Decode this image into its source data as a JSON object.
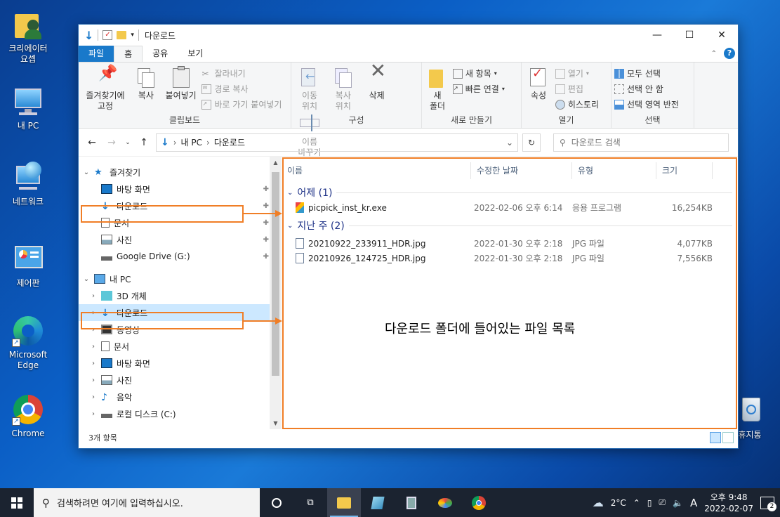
{
  "desktop": {
    "icons": [
      {
        "label": "크리에이터\n요셉"
      },
      {
        "label": "내 PC"
      },
      {
        "label": "네트워크"
      },
      {
        "label": "제어판"
      },
      {
        "label": "Microsoft Edge"
      },
      {
        "label": "Chrome"
      },
      {
        "label": "휴지통"
      }
    ]
  },
  "window": {
    "title": "다운로드",
    "tabs": {
      "file": "파일",
      "home": "홈",
      "share": "공유",
      "view": "보기"
    },
    "ribbon": {
      "clipboard": {
        "pin": "즐겨찾기에\n고정",
        "copy": "복사",
        "paste": "붙여넣기",
        "cut": "잘라내기",
        "copy_path": "경로 복사",
        "paste_shortcut": "바로 가기 붙여넣기",
        "label": "클립보드"
      },
      "organize": {
        "move": "이동\n위치",
        "copy_to": "복사\n위치",
        "delete": "삭제",
        "rename": "이름\n바꾸기",
        "label": "구성"
      },
      "new": {
        "new_folder": "새\n폴더",
        "new_item": "새 항목",
        "easy_access": "빠른 연결",
        "label": "새로 만들기"
      },
      "open": {
        "properties": "속성",
        "open": "열기",
        "edit": "편집",
        "history": "히스토리",
        "label": "열기"
      },
      "select": {
        "select_all": "모두 선택",
        "select_none": "선택 안 함",
        "invert": "선택 영역 반전",
        "label": "선택"
      }
    },
    "address": {
      "crumbs": [
        "내 PC",
        "다운로드"
      ]
    },
    "search_placeholder": "다운로드 검색",
    "nav": {
      "quick_access": "즐겨찾기",
      "quick_items": [
        "바탕 화면",
        "다운로드",
        "문서",
        "사진",
        "Google Drive (G:)"
      ],
      "this_pc": "내 PC",
      "pc_items": [
        "3D 개체",
        "다운로드",
        "동영상",
        "문서",
        "바탕 화면",
        "사진",
        "음악",
        "로컬 디스크 (C:)"
      ]
    },
    "columns": {
      "name": "이름",
      "modified": "수정한 날짜",
      "type": "유형",
      "size": "크기"
    },
    "groups": [
      {
        "title": "어제 (1)",
        "files": [
          {
            "name": "picpick_inst_kr.exe",
            "date": "2022-02-06 오후 6:14",
            "type": "응용 프로그램",
            "size": "16,254KB"
          }
        ]
      },
      {
        "title": "지난 주 (2)",
        "files": [
          {
            "name": "20210922_233911_HDR.jpg",
            "date": "2022-01-30 오후 2:18",
            "type": "JPG 파일",
            "size": "4,077KB"
          },
          {
            "name": "20210926_124725_HDR.jpg",
            "date": "2022-01-30 오후 2:18",
            "type": "JPG 파일",
            "size": "7,556KB"
          }
        ]
      }
    ],
    "annotation": "다운로드 폴더에 들어있는 파일 목록",
    "status": "3개 항목"
  },
  "taskbar": {
    "search_placeholder": "검색하려면 여기에 입력하십시오.",
    "weather": "2°C",
    "ime": "A",
    "time": "오후 9:48",
    "date": "2022-02-07",
    "notifications": "2"
  },
  "colors": {
    "accent": "#1979ca",
    "highlight": "#f07e26",
    "selection": "#cce8ff"
  }
}
